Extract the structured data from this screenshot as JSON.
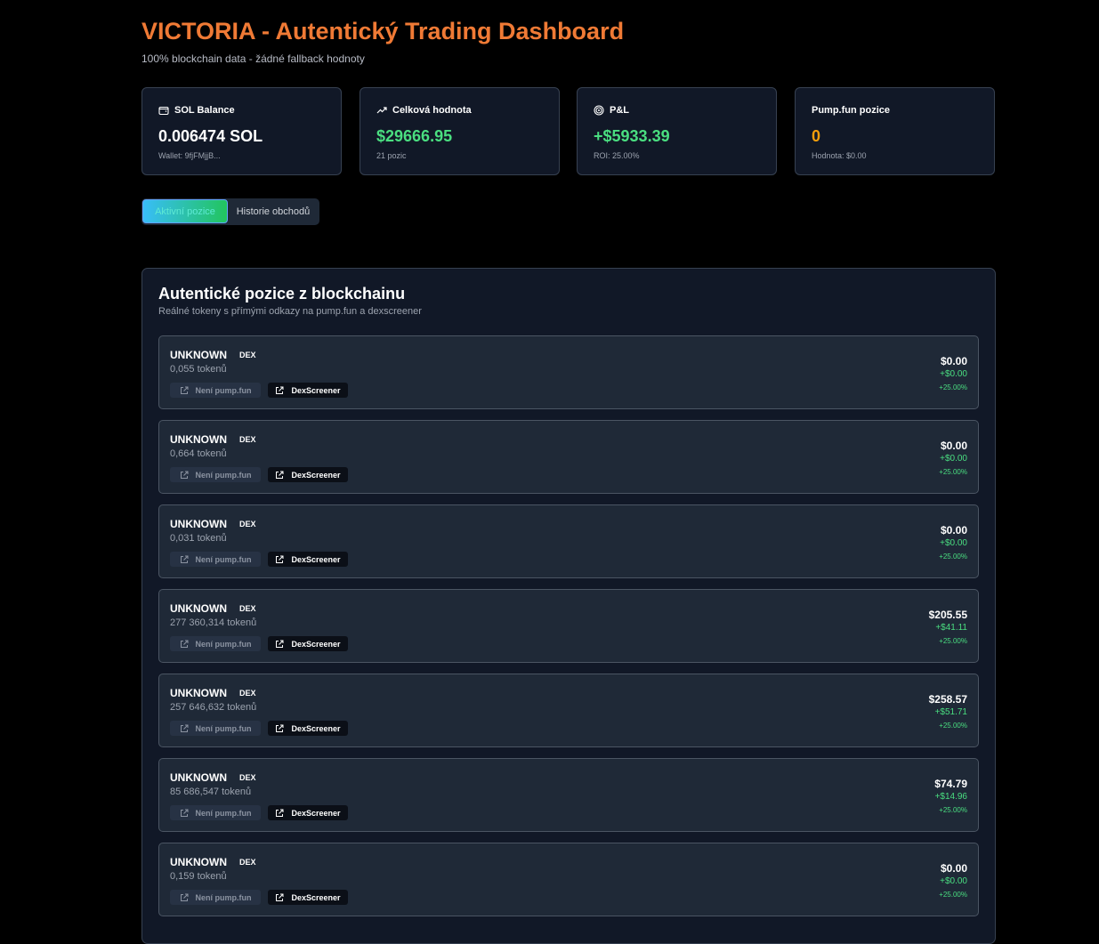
{
  "header": {
    "title": "VICTORIA - Autentický Trading Dashboard",
    "subtitle": "100% blockchain data - žádné fallback hodnoty"
  },
  "colors": {
    "accent": "#f07a35",
    "positive": "#4ade80",
    "orange_value": "#f59e0b"
  },
  "cards": [
    {
      "icon": "wallet-icon",
      "label": "SOL Balance",
      "value": "0.006474 SOL",
      "sub": "Wallet: 9fjFMjjB..."
    },
    {
      "icon": "trending-up-icon",
      "label": "Celková hodnota",
      "value": "$29666.95",
      "sub": "21 pozic"
    },
    {
      "icon": "target-icon",
      "label": "P&L",
      "value": "+$5933.39",
      "sub": "ROI: 25.00%"
    },
    {
      "icon": "",
      "label": "Pump.fun pozice",
      "value": "0",
      "sub": "Hodnota: $0.00"
    }
  ],
  "tabs": {
    "active": "Aktivní pozice",
    "history": "Historie obchodů"
  },
  "panel": {
    "title": "Autentické pozice z blockchainu",
    "subtitle": "Reálné tokeny s přímými odkazy na pump.fun a dexscreener"
  },
  "positions": [
    {
      "symbol": "UNKNOWN",
      "badge": "DEX",
      "amount": "0,055 tokenů",
      "pump_label": "Není pump.fun",
      "dex_label": "DexScreener",
      "value": "$0.00",
      "pnl": "+$0.00",
      "pct": "+25.00%"
    },
    {
      "symbol": "UNKNOWN",
      "badge": "DEX",
      "amount": "0,664 tokenů",
      "pump_label": "Není pump.fun",
      "dex_label": "DexScreener",
      "value": "$0.00",
      "pnl": "+$0.00",
      "pct": "+25.00%"
    },
    {
      "symbol": "UNKNOWN",
      "badge": "DEX",
      "amount": "0,031 tokenů",
      "pump_label": "Není pump.fun",
      "dex_label": "DexScreener",
      "value": "$0.00",
      "pnl": "+$0.00",
      "pct": "+25.00%"
    },
    {
      "symbol": "UNKNOWN",
      "badge": "DEX",
      "amount": "277 360,314 tokenů",
      "pump_label": "Není pump.fun",
      "dex_label": "DexScreener",
      "value": "$205.55",
      "pnl": "+$41.11",
      "pct": "+25.00%"
    },
    {
      "symbol": "UNKNOWN",
      "badge": "DEX",
      "amount": "257 646,632 tokenů",
      "pump_label": "Není pump.fun",
      "dex_label": "DexScreener",
      "value": "$258.57",
      "pnl": "+$51.71",
      "pct": "+25.00%"
    },
    {
      "symbol": "UNKNOWN",
      "badge": "DEX",
      "amount": "85 686,547 tokenů",
      "pump_label": "Není pump.fun",
      "dex_label": "DexScreener",
      "value": "$74.79",
      "pnl": "+$14.96",
      "pct": "+25.00%"
    },
    {
      "symbol": "UNKNOWN",
      "badge": "DEX",
      "amount": "0,159 tokenů",
      "pump_label": "Není pump.fun",
      "dex_label": "DexScreener",
      "value": "$0.00",
      "pnl": "+$0.00",
      "pct": "+25.00%"
    }
  ]
}
